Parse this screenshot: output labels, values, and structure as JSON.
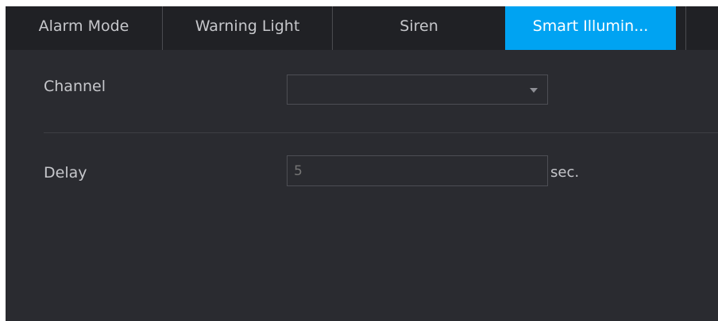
{
  "tabs": [
    {
      "label": "Alarm Mode",
      "active": false
    },
    {
      "label": "Warning Light",
      "active": false
    },
    {
      "label": "Siren",
      "active": false
    },
    {
      "label": "Smart Illumin...",
      "active": true
    }
  ],
  "form": {
    "channel": {
      "label": "Channel",
      "value": ""
    },
    "delay": {
      "label": "Delay",
      "placeholder": "5",
      "value": "",
      "unit": "sec."
    }
  },
  "colors": {
    "accent": "#00a3f2",
    "panel_bg": "#2a2b30",
    "tabbar_bg": "#202125",
    "text": "#c6c7cb"
  },
  "icons": {
    "channel_dropdown": "dropdown-arrow-icon"
  }
}
